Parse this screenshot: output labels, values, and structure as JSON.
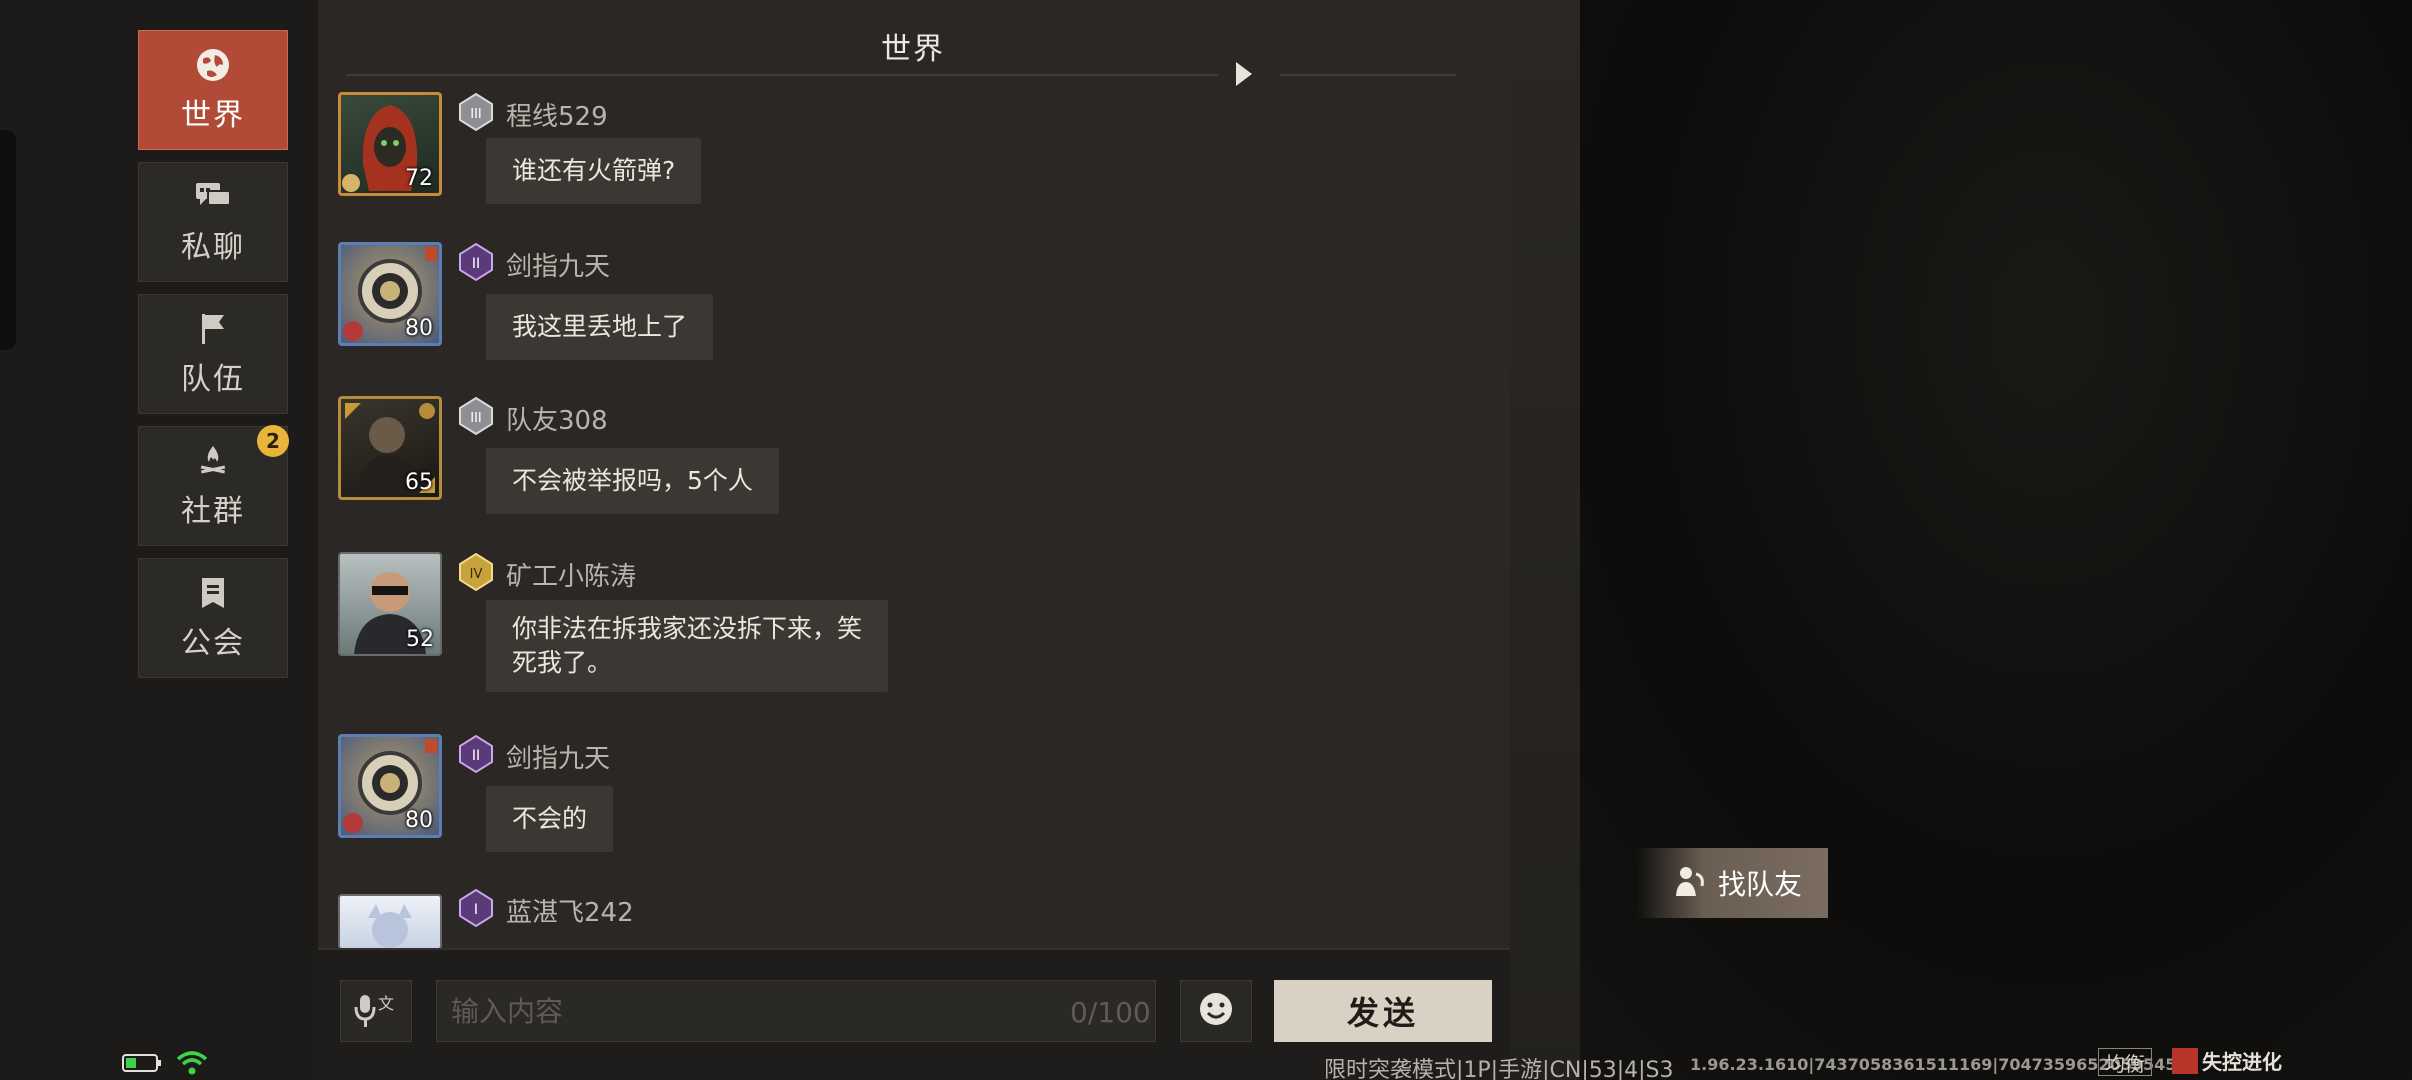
{
  "sidebar": {
    "tabs": [
      {
        "label": "世界",
        "icon": "globe-icon",
        "active": true
      },
      {
        "label": "私聊",
        "icon": "chat-bubbles-icon"
      },
      {
        "label": "队伍",
        "icon": "flag-icon"
      },
      {
        "label": "社群",
        "icon": "campfire-icon",
        "badge": "2"
      },
      {
        "label": "公会",
        "icon": "guild-banner-icon"
      }
    ]
  },
  "chat": {
    "title": "世界",
    "messages": [
      {
        "name": "程线529",
        "level": "72",
        "rank": "III",
        "text": "谁还有火箭弹?"
      },
      {
        "name": "剑指九天",
        "level": "80",
        "rank": "II",
        "text": "我这里丢地上了"
      },
      {
        "name": "队友308",
        "level": "65",
        "rank": "III",
        "text": "不会被举报吗，5个人"
      },
      {
        "name": "矿工小陈涛",
        "level": "52",
        "rank": "IV",
        "text_line1": "你非法在拆我家还没拆下来，笑",
        "text_line2": "死我了。"
      },
      {
        "name": "剑指九天",
        "level": "80",
        "rank": "II",
        "text": "不会的"
      },
      {
        "name": "蓝湛飞242",
        "rank": "I"
      }
    ],
    "find_team_label": "找队友"
  },
  "input": {
    "placeholder": "输入内容",
    "counter": "0/100",
    "send_label": "发送"
  },
  "status": {
    "mode_text": "限时突袭模式|1P|手游|CN|53|4|S3",
    "version_text": "1.96.23.1610|7437058361511169|7047359652059545 7",
    "balance_label": "均衡",
    "logo_text": "失控进化"
  },
  "colors": {
    "active_tab": "#b24a38",
    "badge": "#e8b53a",
    "send_button": "#d9d1c3",
    "battery": "#3fd34a"
  }
}
